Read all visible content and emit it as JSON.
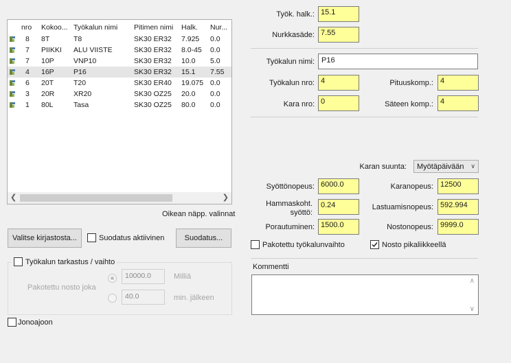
{
  "tool_list": {
    "columns": [
      "nro",
      "Kokoo...",
      "Työkalun  nimi",
      "Pitimen nimi",
      "Halk.",
      "Nur..."
    ],
    "rows": [
      {
        "nro": "8",
        "kokoo": "8T",
        "nimi": "T8",
        "pidin": "SK30 ER32",
        "halk": "7.925",
        "nur": "0.0",
        "selected": false
      },
      {
        "nro": "7",
        "kokoo": "PIIKKI",
        "nimi": "ALU VIISTE",
        "pidin": "SK30 ER32",
        "halk": "8.0-45",
        "nur": "0.0",
        "selected": false
      },
      {
        "nro": "7",
        "kokoo": "10P",
        "nimi": "VNP10",
        "pidin": "SK30 ER32",
        "halk": "10.0",
        "nur": "5.0",
        "selected": false
      },
      {
        "nro": "4",
        "kokoo": "16P",
        "nimi": "P16",
        "pidin": "SK30 ER32",
        "halk": "15.1",
        "nur": "7.55",
        "selected": true
      },
      {
        "nro": "6",
        "kokoo": "20T",
        "nimi": "T20",
        "pidin": "SK30 ER40",
        "halk": "19.075",
        "nur": "0.0",
        "selected": false
      },
      {
        "nro": "3",
        "kokoo": "20R",
        "nimi": "XR20",
        "pidin": "SK30 OZ25",
        "halk": "20.0",
        "nur": "0.0",
        "selected": false
      },
      {
        "nro": "1",
        "kokoo": "80L",
        "nimi": "Tasa",
        "pidin": "SK30 OZ25",
        "halk": "80.0",
        "nur": "0.0",
        "selected": false
      }
    ]
  },
  "right_click_hint": "Oikean näpp. valinnat",
  "buttons": {
    "library": "Valitse kirjastosta...",
    "filter_active": "Suodatus aktiivinen",
    "filter": "Suodatus..."
  },
  "tool_check": {
    "label": "Työkalun tarkastus / vaihto",
    "forced_lift": "Pakotettu nosto joka",
    "value1": "10000.0",
    "unit1": "Milliä",
    "value2": "40.0",
    "unit2": "min. jälkeen"
  },
  "queue_label": "Jonoajoon",
  "top_fields": {
    "diameter_label": "Työk. halk.:",
    "diameter_value": "15.1",
    "corner_label": "Nurkkasäde:",
    "corner_value": "7.55"
  },
  "tool_info": {
    "name_label": "Työkalun nimi:",
    "name_value": "P16",
    "number_label": "Työkalun nro:",
    "number_value": "4",
    "length_comp_label": "Pituuskomp.:",
    "length_comp_value": "4",
    "spindle_label": "Kara nro:",
    "spindle_value": "0",
    "radius_comp_label": "Säteen komp.:",
    "radius_comp_value": "4"
  },
  "spindle_dir": {
    "label": "Karan suunta:",
    "value": "Myötäpäivään"
  },
  "speeds": {
    "feed_label": "Syöttönopeus:",
    "feed_value": "6000.0",
    "spindle_speed_label": "Karanopeus:",
    "spindle_speed_value": "12500",
    "tooth_feed_label_1": "Hammaskoht.",
    "tooth_feed_label_2": "syöttö:",
    "tooth_feed_value": "0.24",
    "chip_speed_label": "Lastuamisnopeus:",
    "chip_speed_value": "592.994",
    "drilling_label": "Porautuminen:",
    "drilling_value": "1500.0",
    "lift_label": "Nostonopeus:",
    "lift_value": "9999.0"
  },
  "options": {
    "forced_change": "Pakotettu työkalunvaihto",
    "fast_lift": "Nosto pikaliikkeellä",
    "forced_change_checked": false,
    "fast_lift_checked": true
  },
  "comment_label": "Kommentti"
}
